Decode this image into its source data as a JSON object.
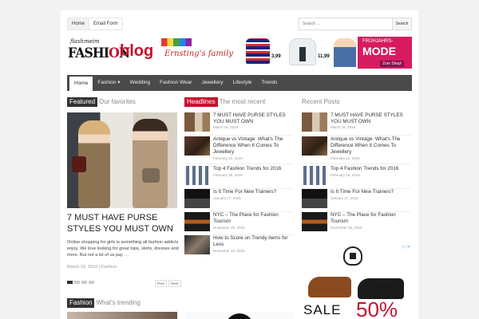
{
  "topnav": {
    "items": [
      "Home",
      "Email Form"
    ]
  },
  "search": {
    "placeholder": "Search ...",
    "button": "Search"
  },
  "logo": {
    "small": "flashmeim",
    "fashion_a": "FASHI",
    "fashion_o": "O",
    "fashion_b": "N",
    "blog": "blog"
  },
  "banner": {
    "brand": "Ernsting's family",
    "price1": "3,99",
    "price2": "11,99",
    "headline_small": "FRÜHJAHRS-",
    "headline": "MODE",
    "cta": "Zum Shop!"
  },
  "mainnav": [
    "Home",
    "Fashion ▾",
    "Wedding",
    "Fashion Wear",
    "Jewellery",
    "Lifestyle",
    "Trends"
  ],
  "featured": {
    "tag": "Featured",
    "rest": "Our favorites",
    "title": "7 MUST HAVE PURSE STYLES YOU MUST OWN",
    "excerpt": "Online shopping for girls is something all fashion addicts enjoy. We love looking for great tops, skirts, dresses and more. But not a lot of us pay …",
    "date": "March 16, 2016",
    "category": "Fashion",
    "prev": "Prev",
    "next": "Next"
  },
  "headlines": {
    "tag": "Headlines",
    "rest": "The most recent",
    "items": [
      {
        "title": "7 MUST HAVE PURSE STYLES YOU MUST OWN",
        "date": "March 16, 2016"
      },
      {
        "title": "Antique vs Vintage: What's The Difference When It Comes To Jewellery",
        "date": "February 21, 2016"
      },
      {
        "title": "Top 4 Fashion Trends for 2016",
        "date": "February 16, 2016"
      },
      {
        "title": "Is It Time For New Trainers?",
        "date": "January 17, 2016"
      },
      {
        "title": "NYC – The Place for Fashion Tourism",
        "date": "November 26, 2015"
      },
      {
        "title": "How to Score on Trendy items for Less",
        "date": "November 23, 2015"
      }
    ]
  },
  "recent": {
    "title": "Recent Posts",
    "items": [
      {
        "title": "7 MUST HAVE PURSE STYLES YOU MUST OWN",
        "date": "March 16, 2016"
      },
      {
        "title": "Antique vs Vintage: What's The Difference When It Comes To Jewellery",
        "date": "February 21, 2016"
      },
      {
        "title": "Top 4 Fashion Trends for 2016",
        "date": "February 16, 2016"
      },
      {
        "title": "Is It Time For New Trainers?",
        "date": "January 17, 2016"
      },
      {
        "title": "NYC – The Place for Fashion Tourism",
        "date": "November 26, 2015"
      }
    ]
  },
  "fashion_section": {
    "tag": "Fashion",
    "rest": "What's trending"
  },
  "shoe_ad": {
    "sale": "SALE",
    "pct": "50%",
    "ad_icons": "▷ ✕"
  }
}
